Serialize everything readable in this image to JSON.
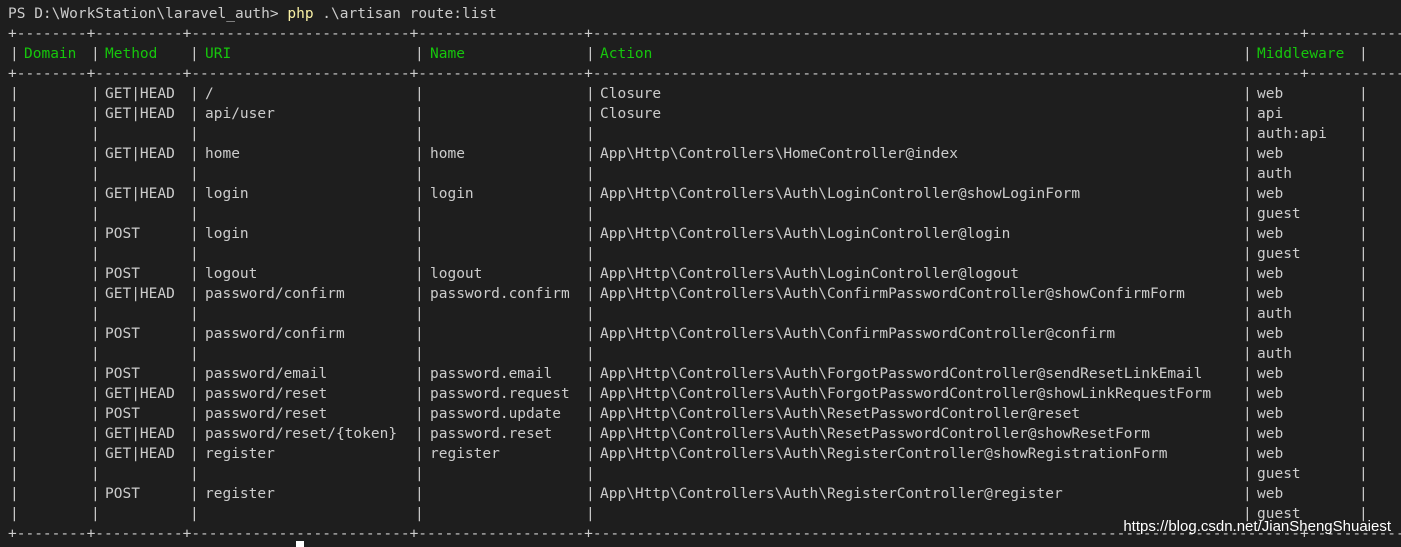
{
  "window": {
    "prompt": "PS D:\\WorkStation\\laravel_auth> ",
    "command_exe": "php",
    "command_args": " .\\artisan route:list"
  },
  "table": {
    "columns": [
      "Domain",
      "Method",
      "URI",
      "Name",
      "Action",
      "Middleware"
    ],
    "rows": [
      [
        "",
        "GET|HEAD",
        "/",
        "",
        "Closure",
        "web"
      ],
      [
        "",
        "GET|HEAD",
        "api/user",
        "",
        "Closure",
        "api"
      ],
      [
        "",
        "",
        "",
        "",
        "",
        "auth:api"
      ],
      [
        "",
        "GET|HEAD",
        "home",
        "home",
        "App\\Http\\Controllers\\HomeController@index",
        "web"
      ],
      [
        "",
        "",
        "",
        "",
        "",
        "auth"
      ],
      [
        "",
        "GET|HEAD",
        "login",
        "login",
        "App\\Http\\Controllers\\Auth\\LoginController@showLoginForm",
        "web"
      ],
      [
        "",
        "",
        "",
        "",
        "",
        "guest"
      ],
      [
        "",
        "POST",
        "login",
        "",
        "App\\Http\\Controllers\\Auth\\LoginController@login",
        "web"
      ],
      [
        "",
        "",
        "",
        "",
        "",
        "guest"
      ],
      [
        "",
        "POST",
        "logout",
        "logout",
        "App\\Http\\Controllers\\Auth\\LoginController@logout",
        "web"
      ],
      [
        "",
        "GET|HEAD",
        "password/confirm",
        "password.confirm",
        "App\\Http\\Controllers\\Auth\\ConfirmPasswordController@showConfirmForm",
        "web"
      ],
      [
        "",
        "",
        "",
        "",
        "",
        "auth"
      ],
      [
        "",
        "POST",
        "password/confirm",
        "",
        "App\\Http\\Controllers\\Auth\\ConfirmPasswordController@confirm",
        "web"
      ],
      [
        "",
        "",
        "",
        "",
        "",
        "auth"
      ],
      [
        "",
        "POST",
        "password/email",
        "password.email",
        "App\\Http\\Controllers\\Auth\\ForgotPasswordController@sendResetLinkEmail",
        "web"
      ],
      [
        "",
        "GET|HEAD",
        "password/reset",
        "password.request",
        "App\\Http\\Controllers\\Auth\\ForgotPasswordController@showLinkRequestForm",
        "web"
      ],
      [
        "",
        "POST",
        "password/reset",
        "password.update",
        "App\\Http\\Controllers\\Auth\\ResetPasswordController@reset",
        "web"
      ],
      [
        "",
        "GET|HEAD",
        "password/reset/{token}",
        "password.reset",
        "App\\Http\\Controllers\\Auth\\ResetPasswordController@showResetForm",
        "web"
      ],
      [
        "",
        "GET|HEAD",
        "register",
        "register",
        "App\\Http\\Controllers\\Auth\\RegisterController@showRegistrationForm",
        "web"
      ],
      [
        "",
        "",
        "",
        "",
        "",
        "guest"
      ],
      [
        "",
        "POST",
        "register",
        "",
        "App\\Http\\Controllers\\Auth\\RegisterController@register",
        "web"
      ],
      [
        "",
        "",
        "",
        "",
        "",
        "guest"
      ]
    ]
  },
  "watermark": "https://blog.csdn.net/JianShengShuaiest",
  "colors": {
    "background": "#1e1e1e",
    "text": "#cccccc",
    "header": "#16c60c",
    "command": "#f9f1a5"
  }
}
